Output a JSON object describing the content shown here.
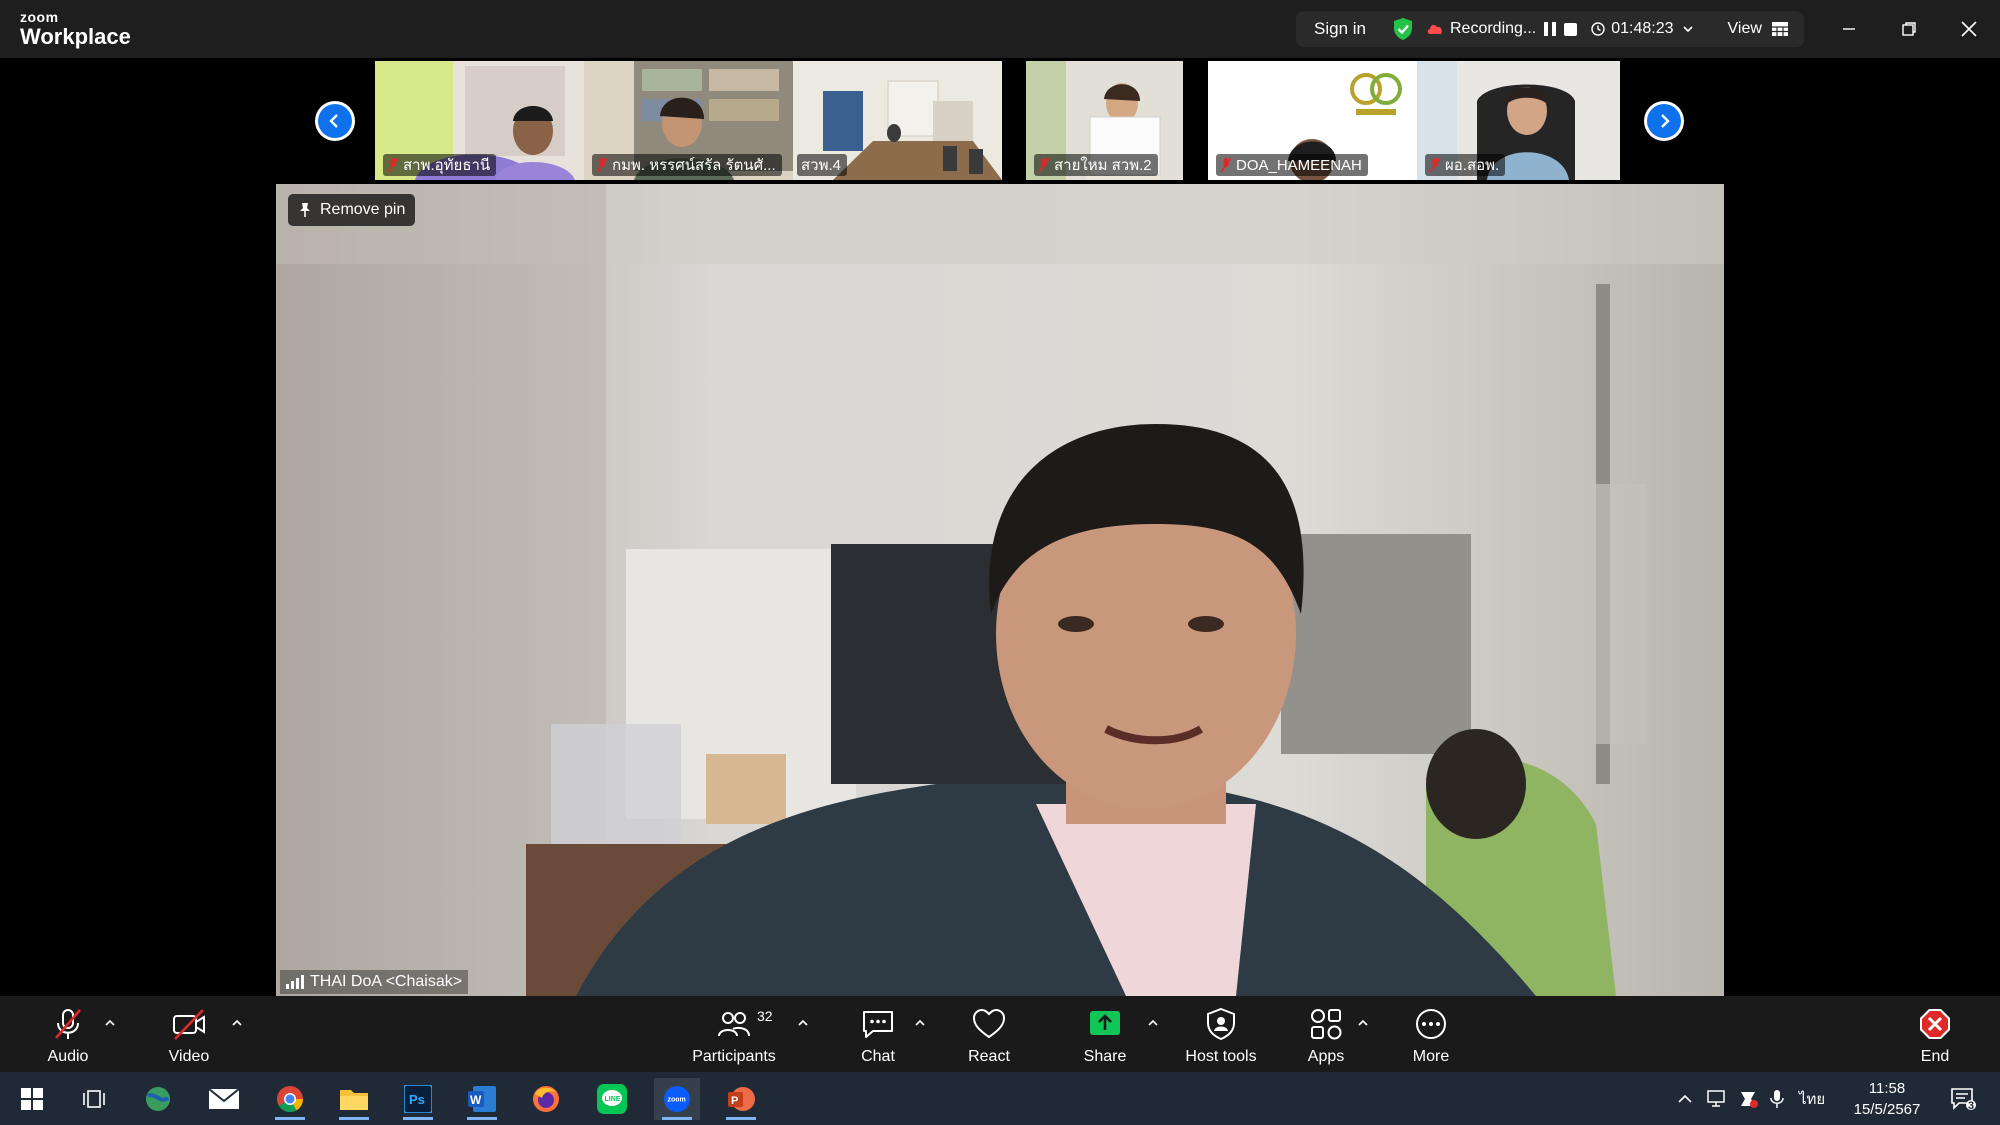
{
  "app": {
    "brand_small": "zoom",
    "brand_big": "Workplace"
  },
  "meeting_bar": {
    "sign_in": "Sign in",
    "recording_label": "Recording...",
    "elapsed": "01:48:23",
    "view_label": "View"
  },
  "thumbnails": [
    {
      "name": "สาพ.อุทัยธานี"
    },
    {
      "name": "กมพ. หรรศน์สรัล รัตนศั..."
    },
    {
      "name": "สวพ.4"
    },
    {
      "name": "สายใหม สวพ.2"
    },
    {
      "name": "DOA_HAMEENAH"
    },
    {
      "name": "ผอ.สอพ."
    }
  ],
  "main_video": {
    "remove_pin": "Remove pin",
    "speaker": "THAI DoA <Chaisak>"
  },
  "toolbar": {
    "audio": "Audio",
    "video": "Video",
    "participants": "Participants",
    "participant_count": "32",
    "chat": "Chat",
    "react": "React",
    "share": "Share",
    "host_tools": "Host tools",
    "apps": "Apps",
    "more": "More",
    "end": "End"
  },
  "taskbar": {
    "apps": [
      "windows-start",
      "task-view",
      "globe-app",
      "mail",
      "chrome",
      "file-explorer",
      "photoshop",
      "word",
      "firefox",
      "line",
      "zoom",
      "powerpoint"
    ],
    "language": "ไทย",
    "time": "11:58",
    "date": "15/5/2567",
    "notification_count": "3"
  },
  "colors": {
    "accent": "#0e72ed",
    "share_green": "#0fc656",
    "end_red": "#e02828",
    "muted_red": "#e02828"
  }
}
